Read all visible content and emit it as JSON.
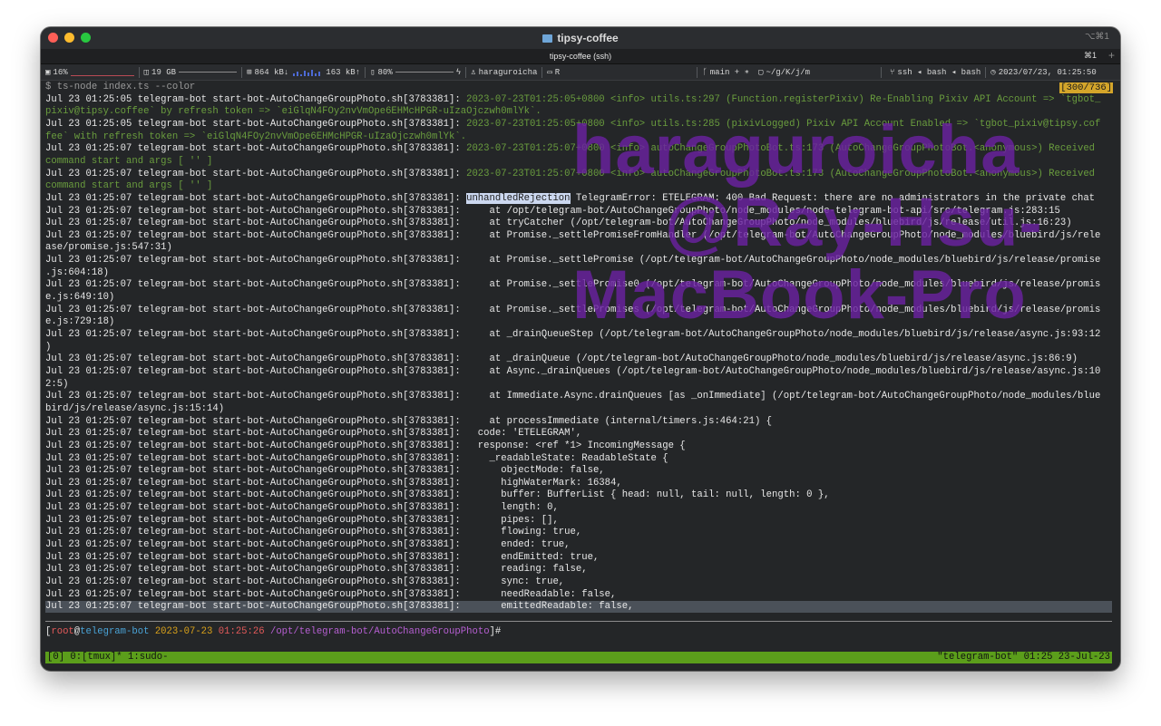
{
  "window": {
    "title": "tipsy-coffee",
    "title_shortcut": "⌥⌘1",
    "tab_label": "tipsy-coffee (ssh)",
    "tab_shortcut": "⌘1",
    "tab_add": "+"
  },
  "statusbar": {
    "cpu": "16%",
    "disk": "19 GB",
    "net_down": "864 kB↓",
    "net_up": "163 kB↑",
    "battery": "80%",
    "user": "haraguroicha",
    "r_label": "R",
    "git_branch": "main + ∗",
    "cwd": "~/g/K/j/m",
    "job": "ssh ◂ bash ◂ bash",
    "datetime": "2023/07/23, 01:25:50"
  },
  "terminal": {
    "counter": "[300/736]",
    "lines": [
      {
        "text": "$ ts-node index.ts --color",
        "kind": "cmd"
      },
      {
        "prefix": "Jul 23 01:25:05 telegram-bot start-bot-AutoChangeGroupPhoto.sh[3783381]: ",
        "green": "2023-07-23T01:25:05+0800 <info> utils.ts:297 (Function.registerPixiv) Re-Enabling Pixiv API Account => `tgbot_"
      },
      {
        "green": "pixiv@tipsy.coffee` by refresh token => `eiGlqN4FOy2nvVmOpe6EHMcHPGR-uIzaOjczwh0mlYk`."
      },
      {
        "prefix": "Jul 23 01:25:05 telegram-bot start-bot-AutoChangeGroupPhoto.sh[3783381]: ",
        "green": "2023-07-23T01:25:05+0800 <info> utils.ts:285 (pixivLogged) Pixiv API Account Enabled => `tgbot_pixiv@tipsy.cof"
      },
      {
        "green": "fee` with refresh token => `eiGlqN4FOy2nvVmOpe6EHMcHPGR-uIzaOjczwh0mlYk`."
      },
      {
        "prefix": "Jul 23 01:25:07 telegram-bot start-bot-AutoChangeGroupPhoto.sh[3783381]: ",
        "green": "2023-07-23T01:25:07+0800 <info> autoChangeGroupPhotoBot.ts:173 (AutoChangeGroupPhotoBot.<anonymous>) Received"
      },
      {
        "green": "command start and args [ '' ]"
      },
      {
        "prefix": "Jul 23 01:25:07 telegram-bot start-bot-AutoChangeGroupPhoto.sh[3783381]: ",
        "green": "2023-07-23T01:25:07+0800 <info> autoChangeGroupPhotoBot.ts:173 (AutoChangeGroupPhotoBot.<anonymous>) Received"
      },
      {
        "green": "command start and args [ '' ]"
      },
      {
        "prefix": "Jul 23 01:25:07 telegram-bot start-bot-AutoChangeGroupPhoto.sh[3783381]: ",
        "highlight": "unhandledRejection",
        "text": " TelegramError: ETELEGRAM: 400 Bad Request: there are no administrators in the private chat"
      },
      {
        "text": "Jul 23 01:25:07 telegram-bot start-bot-AutoChangeGroupPhoto.sh[3783381]:     at /opt/telegram-bot/AutoChangeGroupPhoto/node_modules/node-telegram-bot-api/src/telegram.js:283:15"
      },
      {
        "text": "Jul 23 01:25:07 telegram-bot start-bot-AutoChangeGroupPhoto.sh[3783381]:     at tryCatcher (/opt/telegram-bot/AutoChangeGroupPhoto/node_modules/bluebird/js/release/util.js:16:23)"
      },
      {
        "text": "Jul 23 01:25:07 telegram-bot start-bot-AutoChangeGroupPhoto.sh[3783381]:     at Promise._settlePromiseFromHandler (/opt/telegram-bot/AutoChangeGroupPhoto/node_modules/bluebird/js/rele"
      },
      {
        "text": "ase/promise.js:547:31)"
      },
      {
        "text": "Jul 23 01:25:07 telegram-bot start-bot-AutoChangeGroupPhoto.sh[3783381]:     at Promise._settlePromise (/opt/telegram-bot/AutoChangeGroupPhoto/node_modules/bluebird/js/release/promise"
      },
      {
        "text": ".js:604:18)"
      },
      {
        "text": "Jul 23 01:25:07 telegram-bot start-bot-AutoChangeGroupPhoto.sh[3783381]:     at Promise._settlePromise0 (/opt/telegram-bot/AutoChangeGroupPhoto/node_modules/bluebird/js/release/promis"
      },
      {
        "text": "e.js:649:10)"
      },
      {
        "text": "Jul 23 01:25:07 telegram-bot start-bot-AutoChangeGroupPhoto.sh[3783381]:     at Promise._settlePromises (/opt/telegram-bot/AutoChangeGroupPhoto/node_modules/bluebird/js/release/promis"
      },
      {
        "text": "e.js:729:18)"
      },
      {
        "text": "Jul 23 01:25:07 telegram-bot start-bot-AutoChangeGroupPhoto.sh[3783381]:     at _drainQueueStep (/opt/telegram-bot/AutoChangeGroupPhoto/node_modules/bluebird/js/release/async.js:93:12"
      },
      {
        "text": ")"
      },
      {
        "text": "Jul 23 01:25:07 telegram-bot start-bot-AutoChangeGroupPhoto.sh[3783381]:     at _drainQueue (/opt/telegram-bot/AutoChangeGroupPhoto/node_modules/bluebird/js/release/async.js:86:9)"
      },
      {
        "text": "Jul 23 01:25:07 telegram-bot start-bot-AutoChangeGroupPhoto.sh[3783381]:     at Async._drainQueues (/opt/telegram-bot/AutoChangeGroupPhoto/node_modules/bluebird/js/release/async.js:10"
      },
      {
        "text": "2:5)"
      },
      {
        "text": "Jul 23 01:25:07 telegram-bot start-bot-AutoChangeGroupPhoto.sh[3783381]:     at Immediate.Async.drainQueues [as _onImmediate] (/opt/telegram-bot/AutoChangeGroupPhoto/node_modules/blue"
      },
      {
        "text": "bird/js/release/async.js:15:14)"
      },
      {
        "text": "Jul 23 01:25:07 telegram-bot start-bot-AutoChangeGroupPhoto.sh[3783381]:     at processImmediate (internal/timers.js:464:21) {"
      },
      {
        "text": "Jul 23 01:25:07 telegram-bot start-bot-AutoChangeGroupPhoto.sh[3783381]:   code: 'ETELEGRAM',"
      },
      {
        "text": "Jul 23 01:25:07 telegram-bot start-bot-AutoChangeGroupPhoto.sh[3783381]:   response: <ref *1> IncomingMessage {"
      },
      {
        "text": "Jul 23 01:25:07 telegram-bot start-bot-AutoChangeGroupPhoto.sh[3783381]:     _readableState: ReadableState {"
      },
      {
        "text": "Jul 23 01:25:07 telegram-bot start-bot-AutoChangeGroupPhoto.sh[3783381]:       objectMode: false,"
      },
      {
        "text": "Jul 23 01:25:07 telegram-bot start-bot-AutoChangeGroupPhoto.sh[3783381]:       highWaterMark: 16384,"
      },
      {
        "text": "Jul 23 01:25:07 telegram-bot start-bot-AutoChangeGroupPhoto.sh[3783381]:       buffer: BufferList { head: null, tail: null, length: 0 },"
      },
      {
        "text": "Jul 23 01:25:07 telegram-bot start-bot-AutoChangeGroupPhoto.sh[3783381]:       length: 0,"
      },
      {
        "text": "Jul 23 01:25:07 telegram-bot start-bot-AutoChangeGroupPhoto.sh[3783381]:       pipes: [],"
      },
      {
        "text": "Jul 23 01:25:07 telegram-bot start-bot-AutoChangeGroupPhoto.sh[3783381]:       flowing: true,"
      },
      {
        "text": "Jul 23 01:25:07 telegram-bot start-bot-AutoChangeGroupPhoto.sh[3783381]:       ended: true,"
      },
      {
        "text": "Jul 23 01:25:07 telegram-bot start-bot-AutoChangeGroupPhoto.sh[3783381]:       endEmitted: true,"
      },
      {
        "text": "Jul 23 01:25:07 telegram-bot start-bot-AutoChangeGroupPhoto.sh[3783381]:       reading: false,"
      },
      {
        "text": "Jul 23 01:25:07 telegram-bot start-bot-AutoChangeGroupPhoto.sh[3783381]:       sync: true,"
      },
      {
        "text": "Jul 23 01:25:07 telegram-bot start-bot-AutoChangeGroupPhoto.sh[3783381]:       needReadable: false,"
      },
      {
        "text": "Jul 23 01:25:07 telegram-bot start-bot-AutoChangeGroupPhoto.sh[3783381]:       emittedReadable: false,",
        "selected": true
      }
    ]
  },
  "prompt": {
    "open": "[",
    "user": "root",
    "at": "@",
    "host": "telegram-bot",
    "date": "2023-07-23",
    "time": "01:25:26",
    "path": "/opt/telegram-bot/AutoChangeGroupPhoto",
    "close": "]#"
  },
  "tmux": {
    "left": "[0] 0:[tmux]* 1:sudo-",
    "right": "\"telegram-bot\" 01:25 23-Jul-23"
  },
  "watermark": {
    "line1": "haraguroicha",
    "line2": "@Ray-Hsu-",
    "line3": "MacBook-Pro"
  }
}
